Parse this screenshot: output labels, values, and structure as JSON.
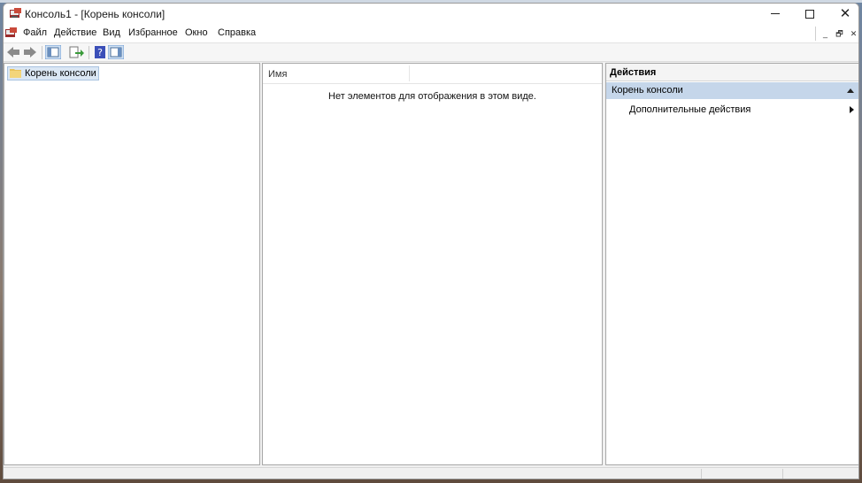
{
  "window": {
    "title": "Консоль1 - [Корень консоли]"
  },
  "menu": {
    "items": [
      "Файл",
      "Действие",
      "Вид",
      "Избранное",
      "Окно",
      "Справка"
    ]
  },
  "toolbar": {
    "buttons": [
      "back-arrow-icon",
      "forward-arrow-icon",
      "show-hide-console-tree-icon",
      "export-list-icon",
      "help-icon",
      "show-hide-action-pane-icon"
    ]
  },
  "tree": {
    "root_label": "Корень консоли"
  },
  "list": {
    "column_name": "Имя",
    "empty_message": "Нет элементов для отображения в этом виде."
  },
  "actions": {
    "header": "Действия",
    "section_title": "Корень консоли",
    "items": [
      "Дополнительные действия"
    ]
  },
  "colors": {
    "selection_bg": "#dbe7f4",
    "section_bg": "#c5d6ea"
  }
}
